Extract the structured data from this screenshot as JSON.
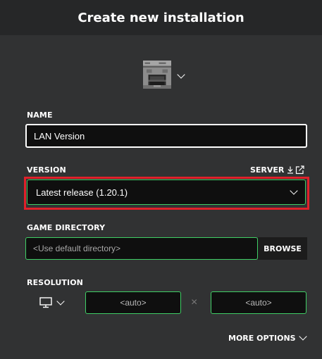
{
  "header": {
    "title": "Create new installation"
  },
  "icon_picker": {
    "icon": "furnace-icon"
  },
  "name": {
    "label": "NAME",
    "value": "LAN Version"
  },
  "version": {
    "label": "VERSION",
    "server_label": "SERVER",
    "selected": "Latest release (1.20.1)",
    "highlight_color": "#e0212a"
  },
  "game_directory": {
    "label": "GAME DIRECTORY",
    "placeholder": "<Use default directory>",
    "browse_label": "BROWSE"
  },
  "resolution": {
    "label": "RESOLUTION",
    "width_placeholder": "<auto>",
    "height_placeholder": "<auto>",
    "separator": "×"
  },
  "more_options": {
    "label": "MORE OPTIONS"
  },
  "colors": {
    "background": "#313233",
    "header": "#262728",
    "field_border_active": "#3fcf65",
    "field_bg": "#0f0f0f"
  }
}
